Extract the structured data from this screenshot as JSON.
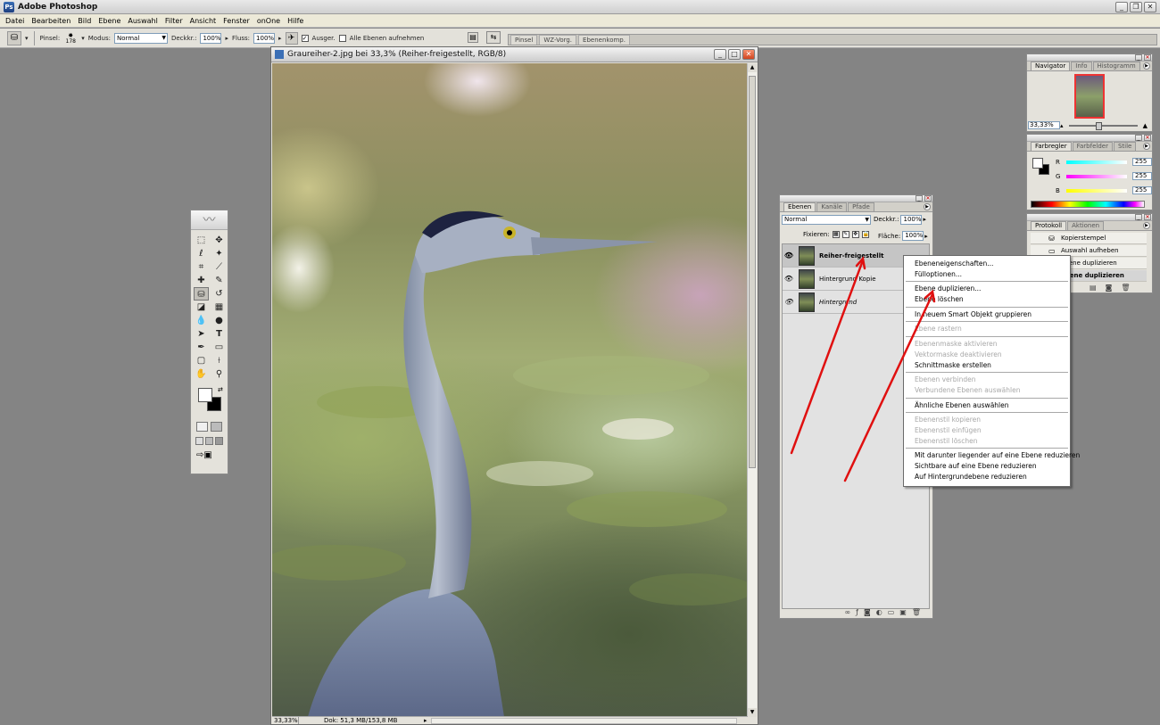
{
  "app": {
    "title": "Adobe Photoshop"
  },
  "menu": [
    "Datei",
    "Bearbeiten",
    "Bild",
    "Ebene",
    "Auswahl",
    "Filter",
    "Ansicht",
    "Fenster",
    "onOne",
    "Hilfe"
  ],
  "options": {
    "brush_label": "Pinsel:",
    "brush_size": "178",
    "mode_label": "Modus:",
    "mode_value": "Normal",
    "opacity_label": "Deckkr.:",
    "opacity_value": "100%",
    "flow_label": "Fluss:",
    "flow_value": "100%",
    "aligned_label": "Ausger.",
    "all_layers_label": "Alle Ebenen aufnehmen",
    "palette_well_tabs": [
      "Pinsel",
      "WZ-Vorg.",
      "Ebenenkomp."
    ]
  },
  "document": {
    "title": "Graureiher-2.jpg bei 33,3% (Reiher-freigestellt, RGB/8)",
    "zoom": "33,33%",
    "doc_info": "Dok: 51,3 MB/153,8 MB"
  },
  "navigator": {
    "tabs": [
      "Navigator",
      "Info",
      "Histogramm"
    ],
    "zoom": "33,33%"
  },
  "color": {
    "tabs": [
      "Farbregler",
      "Farbfelder",
      "Stile"
    ],
    "channels": [
      {
        "name": "R",
        "value": "255",
        "gradient": "linear-gradient(90deg,#0ff,#fff)"
      },
      {
        "name": "G",
        "value": "255",
        "gradient": "linear-gradient(90deg,#f0f,#fff)"
      },
      {
        "name": "B",
        "value": "255",
        "gradient": "linear-gradient(90deg,#ff0,#fff)"
      }
    ]
  },
  "history": {
    "tabs": [
      "Protokoll",
      "Aktionen"
    ],
    "items": [
      {
        "label": "Kopierstempel"
      },
      {
        "label": "Auswahl aufheben"
      },
      {
        "label": "Ebene duplizieren"
      },
      {
        "label": "Ebene duplizieren"
      }
    ]
  },
  "layers": {
    "tabs": [
      "Ebenen",
      "Kanäle",
      "Pfade"
    ],
    "blend_mode": "Normal",
    "opacity_label": "Deckkr.:",
    "opacity": "100%",
    "lock_label": "Fixieren:",
    "fill_label": "Fläche:",
    "fill": "100%",
    "items": [
      {
        "name": "Reiher-freigestellt"
      },
      {
        "name": "Hintergrund Kopie"
      },
      {
        "name": "Hintergrund"
      }
    ]
  },
  "context_menu": {
    "groups": [
      [
        {
          "label": "Ebeneneigenschaften...",
          "enabled": true
        },
        {
          "label": "Fülloptionen...",
          "enabled": true
        }
      ],
      [
        {
          "label": "Ebene duplizieren...",
          "enabled": true
        },
        {
          "label": "Ebene löschen",
          "enabled": true
        }
      ],
      [
        {
          "label": "In neuem Smart Objekt gruppieren",
          "enabled": true
        }
      ],
      [
        {
          "label": "Ebene rastern",
          "enabled": false
        }
      ],
      [
        {
          "label": "Ebenenmaske aktivieren",
          "enabled": false
        },
        {
          "label": "Vektormaske deaktivieren",
          "enabled": false
        },
        {
          "label": "Schnittmaske erstellen",
          "enabled": true
        }
      ],
      [
        {
          "label": "Ebenen verbinden",
          "enabled": false
        },
        {
          "label": "Verbundene Ebenen auswählen",
          "enabled": false
        }
      ],
      [
        {
          "label": "Ähnliche Ebenen auswählen",
          "enabled": true
        }
      ],
      [
        {
          "label": "Ebenenstil kopieren",
          "enabled": false
        },
        {
          "label": "Ebenenstil einfügen",
          "enabled": false
        },
        {
          "label": "Ebenenstil löschen",
          "enabled": false
        }
      ],
      [
        {
          "label": "Mit darunter liegender auf eine Ebene reduzieren",
          "enabled": true
        },
        {
          "label": "Sichtbare auf eine Ebene reduzieren",
          "enabled": true
        },
        {
          "label": "Auf Hintergrundebene reduzieren",
          "enabled": true
        }
      ]
    ]
  },
  "annotation_color": "#e01010"
}
